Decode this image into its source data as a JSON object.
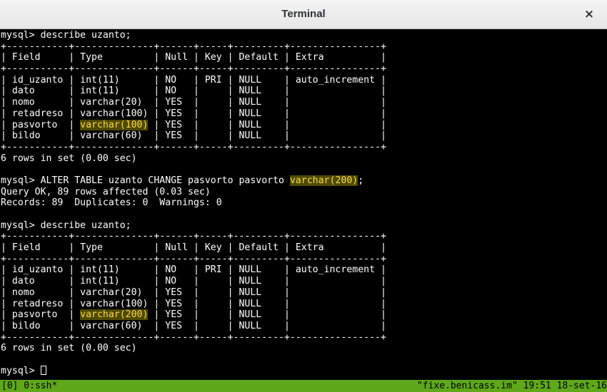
{
  "window": {
    "title": "Terminal",
    "close_glyph": "×",
    "close_icon": "close-icon"
  },
  "terminal": {
    "lines": [
      "mysql> describe uzanto;",
      "+-----------+--------------+------+-----+---------+----------------+",
      "| Field     | Type         | Null | Key | Default | Extra          |",
      "+-----------+--------------+------+-----+---------+----------------+",
      "| id_uzanto | int(11)      | NO   | PRI | NULL    | auto_increment |",
      "| dato      | int(11)      | NO   |     | NULL    |                |",
      "| nomo      | varchar(20)  | YES  |     | NULL    |                |",
      "| retadreso | varchar(100) | YES  |     | NULL    |                |",
      "| pasvorto  | varchar(100) | YES  |     | NULL    |                |",
      "| bildo     | varchar(60)  | YES  |     | NULL    |                |",
      "+-----------+--------------+------+-----+---------+----------------+",
      "6 rows in set (0.00 sec)",
      "",
      "mysql> ALTER TABLE uzanto CHANGE pasvorto pasvorto varchar(200);",
      "Query OK, 89 rows affected (0.03 sec)",
      "Records: 89  Duplicates: 0  Warnings: 0",
      "",
      "mysql> describe uzanto;",
      "+-----------+--------------+------+-----+---------+----------------+",
      "| Field     | Type         | Null | Key | Default | Extra          |",
      "+-----------+--------------+------+-----+---------+----------------+",
      "| id_uzanto | int(11)      | NO   | PRI | NULL    | auto_increment |",
      "| dato      | int(11)      | NO   |     | NULL    |                |",
      "| nomo      | varchar(20)  | YES  |     | NULL    |                |",
      "| retadreso | varchar(100) | YES  |     | NULL    |                |",
      "| pasvorto  | varchar(200) | YES  |     | NULL    |                |",
      "| bildo     | varchar(60)  | YES  |     | NULL    |                |",
      "+-----------+--------------+------+-----+---------+----------------+",
      "6 rows in set (0.00 sec)",
      "",
      "mysql> "
    ],
    "highlights": [
      {
        "line": 8,
        "text": "varchar(100)"
      },
      {
        "line": 13,
        "text": "varchar(200)"
      },
      {
        "line": 25,
        "text": "varchar(200)"
      }
    ],
    "highlight_colors": {
      "background": "#4e4a00",
      "foreground": "#ffd84a"
    },
    "cursor_line": 30,
    "background_color": "#000000",
    "text_color": "#ffffff"
  },
  "statusbar": {
    "left": "[0] 0:ssh*",
    "right": "\"fixe.benicass.im\" 19:51 18-set-16",
    "background_color": "#5fa81a"
  }
}
